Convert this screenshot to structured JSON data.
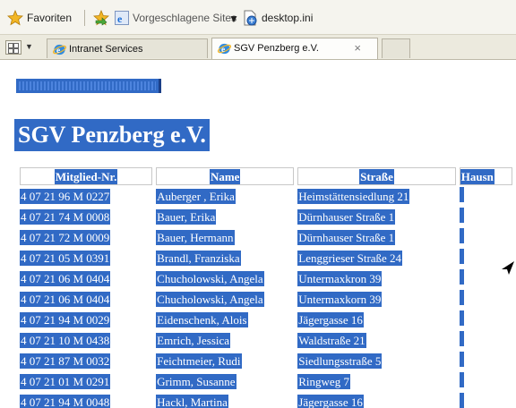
{
  "favorites_bar": {
    "favorites_label": "Favoriten",
    "suggested_sites_label": "Vorgeschlagene Sites",
    "desktop_link_label": "desktop.ini"
  },
  "tabs": [
    {
      "label": "Intranet Services",
      "active": false
    },
    {
      "label": "SGV Penzberg e.V.",
      "active": true
    }
  ],
  "tab_close_symbol": "×",
  "page": {
    "title": "SGV Penzberg e.V.",
    "columns": [
      "Mitglied-Nr.",
      "Name",
      "Straße",
      "Hausn"
    ],
    "rows": [
      [
        "4 07 21 96 M 0227",
        "Auberger , Erika",
        "Heimstättensiedlung 21"
      ],
      [
        "4 07 21 74 M 0008",
        "Bauer, Erika",
        "Dürnhauser Straße 1"
      ],
      [
        "4 07 21 72 M 0009",
        "Bauer, Hermann",
        "Dürnhauser Straße 1"
      ],
      [
        "4 07 21 05 M 0391",
        "Brandl, Franziska",
        "Lenggrieser Straße 24"
      ],
      [
        "4 07 21 06 M 0404",
        "Chucholowski, Angela",
        "Untermaxkron 39"
      ],
      [
        "4 07 21 06 M 0404",
        "Chucholowski, Angela",
        "Untermaxkorn 39"
      ],
      [
        "4 07 21 94 M 0029",
        "Eidenschenk, Alois",
        "Jägergasse 16"
      ],
      [
        "4 07 21 10 M 0438",
        "Emrich, Jessica",
        "Waldstraße 21"
      ],
      [
        "4 07 21 87 M 0032",
        "Feichtmeier, Rudi",
        "Siedlungsstraße 5"
      ],
      [
        "4 07 21 01 M 0291",
        "Grimm, Susanne",
        "Ringweg 7"
      ],
      [
        "4 07 21 94 M 0048",
        "Hackl, Martina",
        "Jägergasse 16"
      ]
    ]
  },
  "colors": {
    "selection": "#316ac5",
    "toolbar_bg": "#f5f4ee"
  },
  "icons": [
    "star-icon",
    "add-favorite-icon",
    "ie-icon",
    "page-icon",
    "quick-tabs-icon",
    "mouse-cursor-icon"
  ]
}
